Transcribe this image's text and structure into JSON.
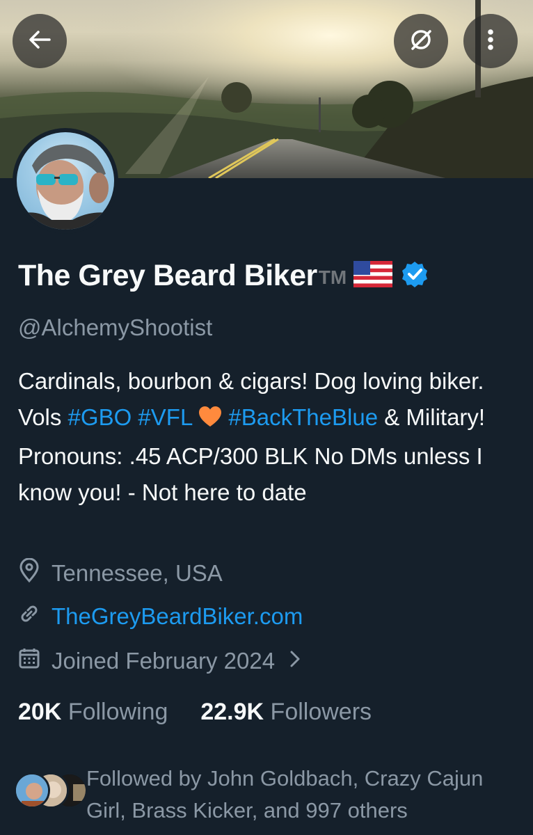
{
  "header": {
    "back_icon": "arrow-left-icon",
    "grok_icon": "slashed-circle-icon",
    "more_icon": "vertical-ellipsis-icon"
  },
  "profile": {
    "display_name": "The Grey Beard Biker",
    "trademark": "TM",
    "handle": "@AlchemyShootist",
    "bio_segments": [
      "Cardinals, bourbon & cigars! Dog loving biker. Vols ",
      "#GBO",
      " ",
      "#VFL",
      " ",
      "#BackTheBlue",
      " & Military! Pronouns: .45 ACP/300 BLK No DMs unless I know you! - Not here to date"
    ],
    "location": "Tennessee, USA",
    "website": "TheGreyBeardBiker.com",
    "joined": "Joined February 2024"
  },
  "stats": {
    "following_count": "20K",
    "following_label": "Following",
    "followers_count": "22.9K",
    "followers_label": "Followers"
  },
  "followed_by": {
    "text": "Followed by John Goldbach, Crazy Cajun Girl, Brass Kicker, and 997 others"
  },
  "colors": {
    "background": "#15202b",
    "accent": "#1d9bf0",
    "muted_text": "#8b98a5",
    "verified_badge": "#1d9bf0",
    "heart": "#ff8a3d"
  }
}
